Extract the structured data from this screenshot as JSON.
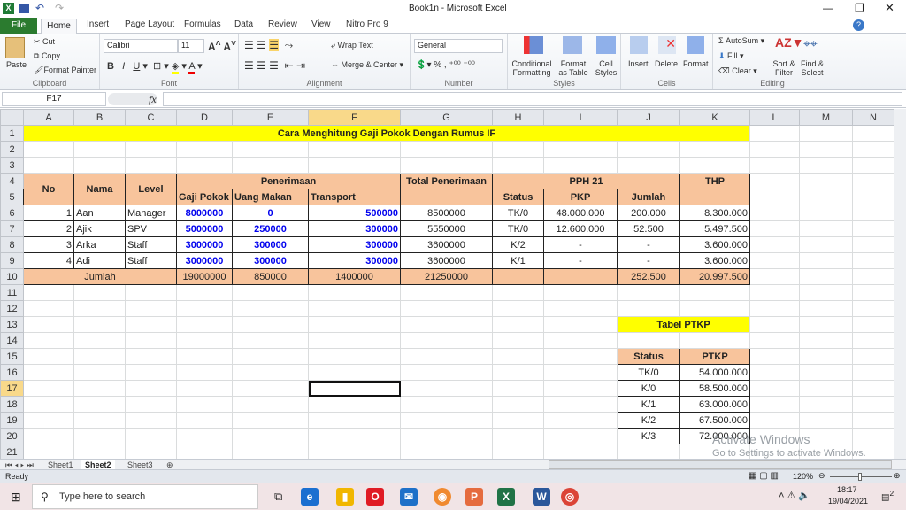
{
  "window": {
    "title": "Book1n  -  Microsoft Excel"
  },
  "ribbon_tabs": [
    "File",
    "Home",
    "Insert",
    "Page Layout",
    "Formulas",
    "Data",
    "Review",
    "View",
    "Nitro Pro 9"
  ],
  "clipboard": {
    "paste": "Paste",
    "cut": "Cut",
    "copy": "Copy",
    "format_painter": "Format Painter",
    "label": "Clipboard"
  },
  "font": {
    "name": "Calibri",
    "size": "11",
    "label": "Font"
  },
  "alignment": {
    "wrap": "Wrap Text",
    "merge": "Merge & Center",
    "label": "Alignment"
  },
  "number": {
    "format": "General",
    "label": "Number"
  },
  "styles": {
    "cond": "Conditional Formatting",
    "table": "Format as Table",
    "cell": "Cell Styles",
    "label": "Styles"
  },
  "cells": {
    "insert": "Insert",
    "delete": "Delete",
    "format": "Format",
    "label": "Cells"
  },
  "editing": {
    "autosum": "AutoSum",
    "fill": "Fill",
    "clear": "Clear",
    "sort": "Sort & Filter",
    "find": "Find & Select",
    "label": "Editing"
  },
  "formula_bar": {
    "name_box": "F17",
    "fx": "fx",
    "formula": ""
  },
  "columns": [
    "A",
    "B",
    "C",
    "D",
    "E",
    "F",
    "G",
    "H",
    "I",
    "J",
    "K",
    "L",
    "M",
    "N"
  ],
  "selected_cell": "F17",
  "sheet": {
    "title": "Cara Menghitung Gaji Pokok Dengan Rumus IF",
    "headers": {
      "no": "No",
      "nama": "Nama",
      "level": "Level",
      "penerimaan": "Penerimaan",
      "gaji": "Gaji Pokok",
      "makan": "Uang Makan",
      "transport": "Transport",
      "total": "Total Penerimaan",
      "pph": "PPH 21",
      "status": "Status",
      "pkp": "PKP",
      "jumlah": "Jumlah",
      "thp": "THP"
    },
    "rows": [
      [
        "1",
        "Aan",
        "Manager",
        "8000000",
        "0",
        "500000",
        "8500000",
        "TK/0",
        "48.000.000",
        "200.000",
        "8.300.000"
      ],
      [
        "2",
        "Ajik",
        "SPV",
        "5000000",
        "250000",
        "300000",
        "5550000",
        "TK/0",
        "12.600.000",
        "52.500",
        "5.497.500"
      ],
      [
        "3",
        "Arka",
        "Staff",
        "3000000",
        "300000",
        "300000",
        "3600000",
        "K/2",
        "-",
        "-",
        "3.600.000"
      ],
      [
        "4",
        "Adi",
        "Staff",
        "3000000",
        "300000",
        "300000",
        "3600000",
        "K/1",
        "-",
        "-",
        "3.600.000"
      ]
    ],
    "totals": {
      "label": "Jumlah",
      "gaji": "19000000",
      "makan": "850000",
      "transport": "1400000",
      "total": "21250000",
      "jumlah": "252.500",
      "thp": "20.997.500"
    },
    "ptkp": {
      "title": "Tabel PTKP",
      "status_header": "Status",
      "ptkp_header": "PTKP",
      "rows": [
        [
          "TK/0",
          "54.000.000"
        ],
        [
          "K/0",
          "58.500.000"
        ],
        [
          "K/1",
          "63.000.000"
        ],
        [
          "K/2",
          "67.500.000"
        ],
        [
          "K/3",
          "72.000.000"
        ]
      ]
    }
  },
  "sheet_tabs": [
    "Sheet1",
    "Sheet2",
    "Sheet3"
  ],
  "active_sheet": "Sheet2",
  "status": {
    "mode": "Ready",
    "zoom": "120%"
  },
  "watermark": {
    "line1": "Activate Windows",
    "line2": "Go to Settings to activate Windows."
  },
  "taskbar": {
    "search_placeholder": "Type here to search",
    "time": "18:17",
    "date": "19/04/2021",
    "notifications": "2"
  },
  "colors": {
    "header_fill": "#f8c49c",
    "title_fill": "#ffff00",
    "input_blue": "#0000ee",
    "file_tab": "#2b7b2f"
  }
}
